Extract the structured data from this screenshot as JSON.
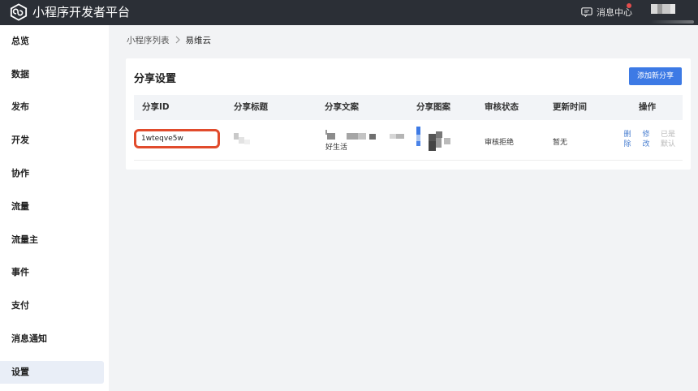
{
  "header": {
    "title": "小程序开发者平台",
    "message_center": "消息中心",
    "logo_icon": "mini-program-logo-icon",
    "message_icon": "chat-bubble-icon",
    "accent": "#2b2f36"
  },
  "sidebar": {
    "items": [
      {
        "label": "总览"
      },
      {
        "label": "数据"
      },
      {
        "label": "发布"
      },
      {
        "label": "开发"
      },
      {
        "label": "协作"
      },
      {
        "label": "流量"
      },
      {
        "label": "流量主"
      },
      {
        "label": "事件"
      },
      {
        "label": "支付"
      },
      {
        "label": "消息通知"
      },
      {
        "label": "设置"
      }
    ],
    "active_index": 10
  },
  "breadcrumb": {
    "parent": "小程序列表",
    "current": "易维云"
  },
  "share_settings": {
    "title": "分享设置",
    "add_button": "添加新分享",
    "button_color": "#3d7ae5",
    "columns": [
      "分享ID",
      "分享标题",
      "分享文案",
      "分享图案",
      "审核状态",
      "更新时间",
      "操作"
    ],
    "rows": [
      {
        "share_id": "1wteqve5w",
        "text_visible": "好生活",
        "review_status": "审核拒绝",
        "update_time": "暂无",
        "actions": {
          "delete": "删除",
          "edit": "修改",
          "set_default": "已是默认"
        }
      }
    ],
    "highlight_color": "#e14b2c"
  }
}
